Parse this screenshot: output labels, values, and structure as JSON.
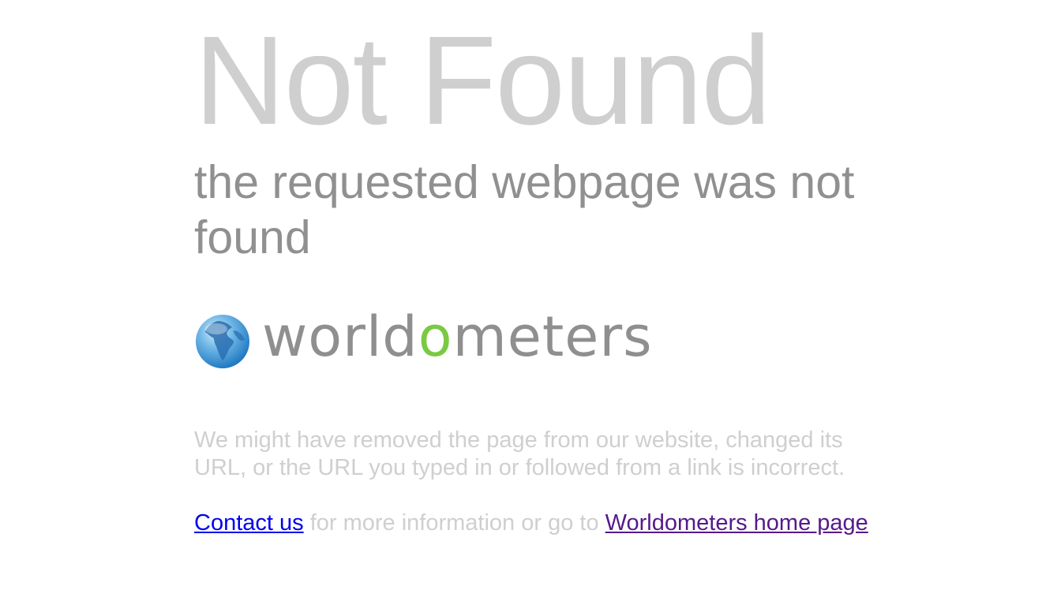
{
  "title": "Not Found",
  "subtitle": "the requested webpage was not found",
  "logo": {
    "icon": "globe-icon",
    "text_part1": "worldo",
    "text_green": "o",
    "text_part1_prefix": "world",
    "text_part2": "meters",
    "brand_gray": "#8f8f8f",
    "brand_green": "#7ac943"
  },
  "description": "We might have removed the page from our website, changed its URL, or the URL you typed in or followed from a link is incorrect.",
  "links": {
    "contact_label": "Contact us",
    "middle_text": " for more information or go to ",
    "home_label": "Worldometers home page"
  },
  "colors": {
    "title": "#cfcfcf",
    "subtitle": "#909090",
    "body_text": "#cfcfcf",
    "link": "#0000ee",
    "visited_link": "#551a8b"
  }
}
